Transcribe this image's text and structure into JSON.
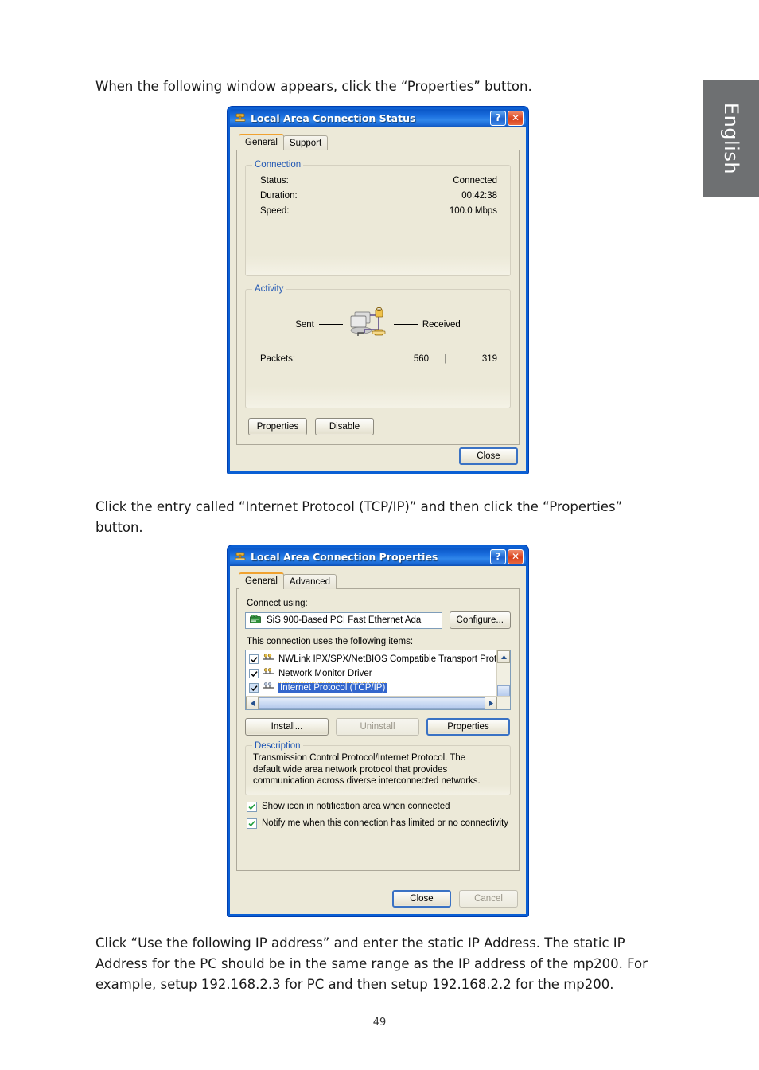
{
  "page": {
    "number": "49",
    "side_tab_label": "English",
    "side_tab_color": "#6e7072"
  },
  "paragraphs": {
    "p1": "When the following window appears, click the “Properties” button.",
    "p2": "Click the entry called “Internet Protocol (TCP/IP)” and then click the “Properties” button.",
    "p3": "Click “Use the following IP address” and enter the static IP Address. The static IP Address for the PC should be in the same range as the IP address of the mp200. For example, setup 192.168.2.3 for PC and then setup 192.168.2.2 for the mp200."
  },
  "status_dialog": {
    "title": "Local Area Connection Status",
    "help_button": "?",
    "close_button": "✕",
    "tabs": [
      {
        "label": "General",
        "active": true
      },
      {
        "label": "Support",
        "active": false
      }
    ],
    "connection_group": {
      "title": "Connection",
      "rows": [
        {
          "label": "Status:",
          "value": "Connected"
        },
        {
          "label": "Duration:",
          "value": "00:42:38"
        },
        {
          "label": "Speed:",
          "value": "100.0 Mbps"
        }
      ]
    },
    "activity_group": {
      "title": "Activity",
      "sent_label": "Sent",
      "received_label": "Received",
      "packets_label": "Packets:",
      "packets_sent": "560",
      "packets_separator": "|",
      "packets_received": "319"
    },
    "buttons": {
      "properties": "Properties",
      "disable": "Disable",
      "close": "Close"
    }
  },
  "properties_dialog": {
    "title": "Local Area Connection Properties",
    "help_button": "?",
    "close_button": "✕",
    "tabs": [
      {
        "label": "General",
        "active": true
      },
      {
        "label": "Advanced",
        "active": false
      }
    ],
    "connect_using_label": "Connect using:",
    "adapter_name": "SiS 900-Based PCI Fast Ethernet Ada",
    "configure_button": "Configure...",
    "items_label": "This connection uses the following items:",
    "items": [
      {
        "label": "NWLink IPX/SPX/NetBIOS Compatible Transport Prot",
        "checked": true,
        "selected": false
      },
      {
        "label": "Network Monitor Driver",
        "checked": true,
        "selected": false
      },
      {
        "label": "Internet Protocol (TCP/IP)",
        "checked": true,
        "selected": true
      }
    ],
    "buttons": {
      "install": "Install...",
      "uninstall": "Uninstall",
      "properties": "Properties",
      "close": "Close",
      "cancel": "Cancel"
    },
    "description": {
      "title": "Description",
      "text": "Transmission Control Protocol/Internet Protocol. The default wide area network protocol that provides communication across diverse interconnected networks."
    },
    "options": [
      {
        "label": "Show icon in notification area when connected",
        "checked": true
      },
      {
        "label": "Notify me when this connection has limited or no connectivity",
        "checked": true
      }
    ]
  }
}
